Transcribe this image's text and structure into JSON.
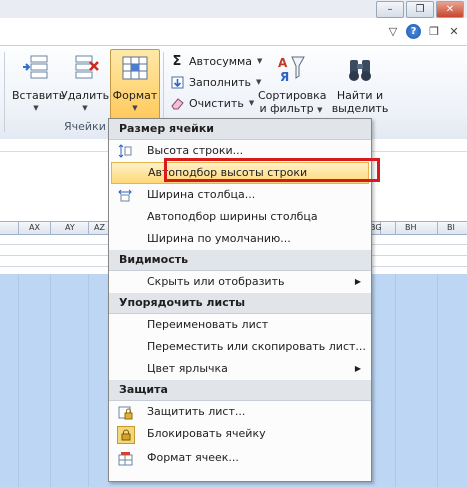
{
  "window": {
    "minimize_label": "–",
    "restore_label": "❐",
    "close_label": "✕"
  },
  "help_row": {
    "minimize_label": "▽",
    "help_label": "?",
    "restore_label": "❐",
    "close_label": "✕"
  },
  "ribbon": {
    "cells_group": {
      "insert_label": "Вставить",
      "delete_label": "Удалить",
      "format_label": "Формат",
      "group_name": "Ячейки"
    },
    "editing_group": {
      "autosum_label": "Автосумма",
      "fill_label": "Заполнить",
      "clear_label": "Очистить",
      "sort_label_line1": "Сортировка",
      "sort_label_line2": "и фильтр",
      "find_label_line1": "Найти и",
      "find_label_line2": "выделить"
    }
  },
  "sheet": {
    "columns": [
      "AX",
      "AY",
      "AZ",
      "BG",
      "BH",
      "BI"
    ]
  },
  "menu": {
    "sections": [
      {
        "header": "Размер ячейки",
        "items": [
          {
            "label": "Высота строки...",
            "icon": "row-height-icon"
          },
          {
            "label": "Автоподбор высоты строки",
            "highlighted": true
          },
          {
            "label": "Ширина столбца...",
            "icon": "column-width-icon"
          },
          {
            "label": "Автоподбор ширины столбца"
          },
          {
            "label": "Ширина по умолчанию..."
          }
        ]
      },
      {
        "header": "Видимость",
        "items": [
          {
            "label": "Скрыть или отобразить",
            "submenu": true
          }
        ]
      },
      {
        "header": "Упорядочить листы",
        "items": [
          {
            "label": "Переименовать лист"
          },
          {
            "label": "Переместить или скопировать лист..."
          },
          {
            "label": "Цвет ярлычка",
            "submenu": true
          }
        ]
      },
      {
        "header": "Защита",
        "items": [
          {
            "label": "Защитить лист...",
            "icon": "protect-sheet-icon"
          },
          {
            "label": "Блокировать ячейку",
            "icon": "lock-icon"
          },
          {
            "label": "Формат ячеек...",
            "icon": "format-cells-icon"
          }
        ]
      }
    ]
  },
  "colors": {
    "highlight_border": "#d8191e",
    "selection_blue": "#bcd6f3",
    "menu_hover": "#ffd877"
  }
}
